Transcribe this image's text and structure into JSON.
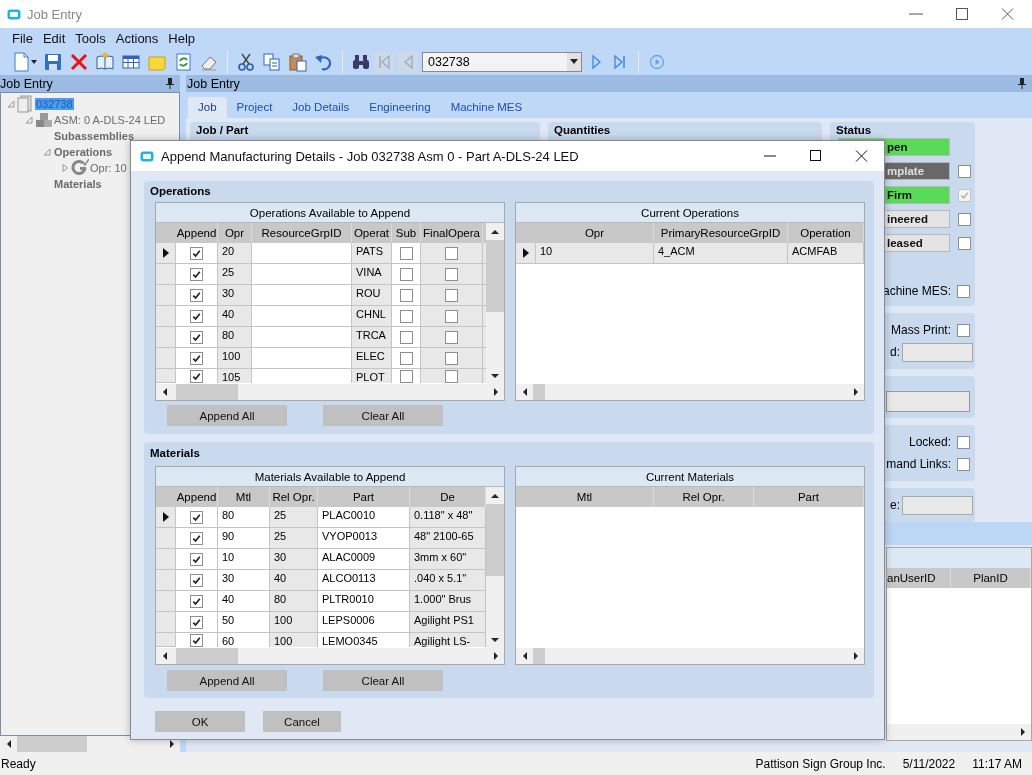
{
  "window": {
    "title": "Job Entry"
  },
  "menu": [
    "File",
    "Edit",
    "Tools",
    "Actions",
    "Help"
  ],
  "toolbar": {
    "record": "032738",
    "navigation": [
      {
        "kind": "first",
        "disabled": true
      },
      {
        "kind": "previous",
        "disabled": true
      },
      {
        "kind": "next",
        "disabled": false
      },
      {
        "kind": "last",
        "disabled": false
      }
    ]
  },
  "tree_panel": {
    "title": "Job Entry",
    "items": [
      {
        "label": "032738",
        "kind": "job",
        "selected": true,
        "expanded": true,
        "children": [
          {
            "label": "ASM: 0 A-DLS-24 LED",
            "kind": "assembly",
            "selected": false,
            "expanded": true,
            "children": [
              {
                "label": "Subassemblies",
                "kind": "group",
                "selected": false
              },
              {
                "label": "Operations",
                "kind": "group",
                "selected": false,
                "expanded": true,
                "children": [
                  {
                    "label": "Opr: 10",
                    "kind": "operation",
                    "selected": false,
                    "expanded": false
                  }
                ]
              },
              {
                "label": "Materials",
                "kind": "group",
                "selected": false
              }
            ]
          }
        ]
      }
    ]
  },
  "form": {
    "title": "Job Entry",
    "tabs": [
      {
        "label": "Job",
        "selected": true
      },
      {
        "label": "Project",
        "selected": false
      },
      {
        "label": "Job Details",
        "selected": false
      },
      {
        "label": "Engineering",
        "selected": false
      },
      {
        "label": "Machine MES",
        "selected": false
      }
    ],
    "sections": [
      {
        "title": "Job / Part"
      },
      {
        "title": "Quantities"
      }
    ],
    "status": {
      "title": "Status",
      "flags": [
        {
          "label": "pen",
          "color": "#58dc58"
        },
        {
          "label": "mplate",
          "color": "#686868",
          "checked": false,
          "disabled": false
        },
        {
          "label": "Firm",
          "color": "#58dc58",
          "checked": true,
          "disabled": true
        },
        {
          "label": "ineered",
          "color": "#e4e4e4",
          "checked": false,
          "disabled": false
        },
        {
          "label": "leased",
          "color": "#e4e4e4",
          "checked": false,
          "disabled": false
        }
      ],
      "panels": [
        [
          {
            "kind": "check",
            "label": "achine MES:",
            "checked": false
          }
        ],
        [
          {
            "kind": "check",
            "label": "Mass Print:",
            "checked": false
          },
          {
            "kind": "field",
            "label": "d:"
          }
        ],
        [
          {
            "kind": "combo"
          }
        ],
        [
          {
            "kind": "check",
            "label": "Locked:",
            "checked": false
          },
          {
            "kind": "check",
            "label": "mand Links:",
            "checked": false
          }
        ],
        [
          {
            "kind": "field",
            "label": "e:"
          }
        ]
      ]
    },
    "grid": {
      "columns": [
        "anUserID",
        "PlanID"
      ]
    }
  },
  "dialog": {
    "title": "Append Manufacturing Details - Job 032738 Asm 0 - Part A-DLS-24 LED",
    "sections": [
      {
        "title": "Operations",
        "available": {
          "title": "Operations Available to Append",
          "columns": [
            {
              "label": "Append",
              "kind": "check",
              "readonly": false
            },
            {
              "label": "Opr",
              "kind": "text",
              "readonly": true
            },
            {
              "label": "ResourceGrpID",
              "kind": "text",
              "readonly": false
            },
            {
              "label": "Operat",
              "kind": "text",
              "readonly": true
            },
            {
              "label": "Sub",
              "kind": "check",
              "readonly": false
            },
            {
              "label": "FinalOpera",
              "kind": "check",
              "readonly": true
            }
          ],
          "rows": [
            {
              "selected": true,
              "cells": [
                true,
                "20",
                null,
                "PATS",
                false,
                false
              ]
            },
            {
              "selected": false,
              "cells": [
                true,
                "25",
                null,
                "VINA",
                false,
                false
              ]
            },
            {
              "selected": false,
              "cells": [
                true,
                "30",
                null,
                "ROU",
                false,
                false
              ]
            },
            {
              "selected": false,
              "cells": [
                true,
                "40",
                null,
                "CHNL",
                false,
                false
              ]
            },
            {
              "selected": false,
              "cells": [
                true,
                "80",
                null,
                "TRCA",
                false,
                false
              ]
            },
            {
              "selected": false,
              "cells": [
                true,
                "100",
                null,
                "ELEC",
                false,
                false
              ]
            },
            {
              "selected": false,
              "cells": [
                true,
                "105",
                null,
                "PLOT",
                false,
                false
              ]
            }
          ]
        },
        "current": {
          "title": "Current Operations",
          "columns": [
            {
              "label": "Opr",
              "readonly": true
            },
            {
              "label": "PrimaryResourceGrpID",
              "readonly": true
            },
            {
              "label": "Operation",
              "readonly": true
            }
          ],
          "rows": [
            {
              "selected": true,
              "cells": [
                "10",
                "4_ACM",
                "ACMFAB"
              ]
            }
          ]
        },
        "buttons": [
          "Append All",
          "Clear All"
        ]
      },
      {
        "title": "Materials",
        "available": {
          "title": "Materials Available to Append",
          "columns": [
            {
              "label": "Append",
              "kind": "check",
              "readonly": false
            },
            {
              "label": "Mtl",
              "kind": "text",
              "readonly": false
            },
            {
              "label": "Rel Opr.",
              "kind": "text",
              "readonly": true
            },
            {
              "label": "Part",
              "kind": "text",
              "readonly": false
            },
            {
              "label": "De",
              "kind": "text",
              "readonly": true
            }
          ],
          "rows": [
            {
              "selected": true,
              "cells": [
                true,
                "80",
                "25",
                "PLAC0010",
                "0.118\" x 48\""
              ]
            },
            {
              "selected": false,
              "cells": [
                true,
                "90",
                "25",
                "VYOP0013",
                "48\" 2100-65"
              ]
            },
            {
              "selected": false,
              "cells": [
                true,
                "10",
                "30",
                "ALAC0009",
                "3mm x 60\""
              ]
            },
            {
              "selected": false,
              "cells": [
                true,
                "30",
                "40",
                "ALCO0113",
                ".040 x 5.1\""
              ]
            },
            {
              "selected": false,
              "cells": [
                true,
                "40",
                "80",
                "PLTR0010",
                "1.000\" Brus"
              ]
            },
            {
              "selected": false,
              "cells": [
                true,
                "50",
                "100",
                "LEPS0006",
                "Agilight PS1"
              ]
            },
            {
              "selected": false,
              "cells": [
                true,
                "60",
                "100",
                "LEMO0345",
                "Agilight  LS-"
              ]
            }
          ]
        },
        "current": {
          "title": "Current Materials",
          "columns": [
            {
              "label": "Mtl"
            },
            {
              "label": "Rel Opr."
            },
            {
              "label": "Part"
            }
          ]
        },
        "buttons": [
          "Append All",
          "Clear All"
        ]
      }
    ],
    "buttons": [
      "OK",
      "Cancel"
    ]
  },
  "status_bar": {
    "message": "Ready",
    "company": "Pattison Sign Group Inc.",
    "date": "5/11/2022",
    "time": "11:17 AM"
  }
}
